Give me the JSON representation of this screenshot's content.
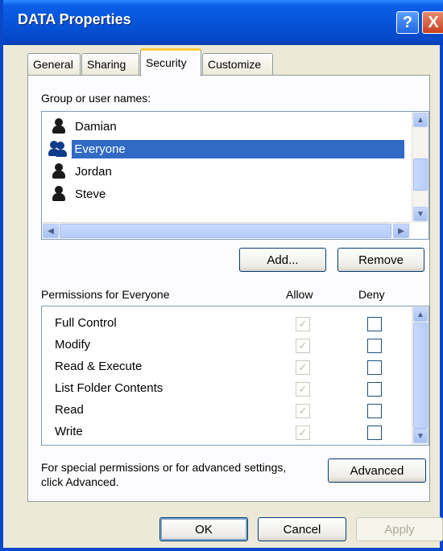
{
  "window": {
    "title": "DATA Properties",
    "help": "?",
    "close": "X"
  },
  "tabs": [
    {
      "label": "General"
    },
    {
      "label": "Sharing"
    },
    {
      "label": "Security",
      "active": true
    },
    {
      "label": "Customize"
    }
  ],
  "security": {
    "group_label": "Group or user names:",
    "users": [
      {
        "name": "Damian",
        "icon": "user-icon"
      },
      {
        "name": "Everyone",
        "icon": "group-icon",
        "selected": true
      },
      {
        "name": "Jordan",
        "icon": "user-icon"
      },
      {
        "name": "Steve",
        "icon": "user-icon"
      }
    ],
    "add_button": "Add...",
    "remove_button": "Remove",
    "permissions_label": "Permissions for Everyone",
    "allow_header": "Allow",
    "deny_header": "Deny",
    "permissions": [
      {
        "name": "Full Control",
        "allow": true,
        "deny": false
      },
      {
        "name": "Modify",
        "allow": true,
        "deny": false
      },
      {
        "name": "Read & Execute",
        "allow": true,
        "deny": false
      },
      {
        "name": "List Folder Contents",
        "allow": true,
        "deny": false
      },
      {
        "name": "Read",
        "allow": true,
        "deny": false
      },
      {
        "name": "Write",
        "allow": true,
        "deny": false
      }
    ],
    "advanced_text_line1": "For special permissions or for advanced settings,",
    "advanced_text_line2": "click Advanced.",
    "advanced_button": "Advanced"
  },
  "buttons": {
    "ok": "OK",
    "cancel": "Cancel",
    "apply": "Apply"
  }
}
